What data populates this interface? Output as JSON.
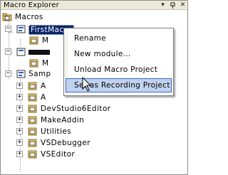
{
  "window": {
    "title": "Macro Explorer",
    "buttons": {
      "dropdown": "▾",
      "pin": "ᵖ",
      "close": "✕"
    }
  },
  "tree": {
    "root": "Macros",
    "nodes": [
      {
        "label": "FirstMacro",
        "expander": "−",
        "selected": true
      },
      {
        "label": "M",
        "expander": ""
      },
      {
        "label": "",
        "expander": "−"
      },
      {
        "label": "M",
        "expander": ""
      },
      {
        "label": "Samp",
        "expander": "−"
      },
      {
        "label": "A",
        "expander": "+"
      },
      {
        "label": "A",
        "expander": "+"
      },
      {
        "label": "DevStudio6Editor",
        "expander": "+"
      },
      {
        "label": "MakeAddin",
        "expander": "+"
      },
      {
        "label": "Utilities",
        "expander": "+"
      },
      {
        "label": "VSDebugger",
        "expander": "+"
      },
      {
        "label": "VSEditor",
        "expander": "+"
      }
    ]
  },
  "context_menu": {
    "items": [
      {
        "label": "Rename"
      },
      {
        "label": "New module..."
      },
      {
        "label": "Unload Macro Project"
      },
      {
        "label": "Set as Recording Project",
        "highlighted": true
      }
    ]
  },
  "colors": {
    "selection": "#0a246a",
    "menu_hover": "#c1d2ee",
    "menu_hover_border": "#316ac5"
  }
}
